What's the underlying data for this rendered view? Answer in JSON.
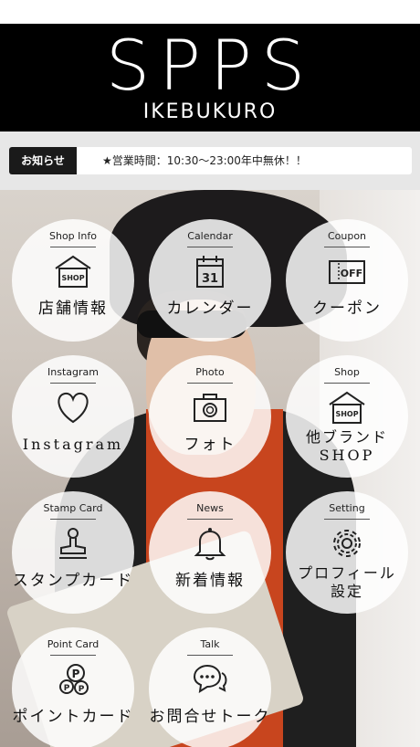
{
  "header": {
    "brand": "SPPS",
    "location": "IKEBUKURO"
  },
  "notice": {
    "label": "お知らせ",
    "text": "★営業時間：10:30〜23:00年中無休！！"
  },
  "menu": [
    {
      "en": "Shop Info",
      "jp": "店舗情報",
      "icon": "shop-icon"
    },
    {
      "en": "Calendar",
      "jp": "カレンダー",
      "icon": "calendar-icon",
      "day": "31"
    },
    {
      "en": "Coupon",
      "jp": "クーポン",
      "icon": "coupon-icon",
      "tag": "OFF"
    },
    {
      "en": "Instagram",
      "jp": "Instagram",
      "icon": "heart-icon"
    },
    {
      "en": "Photo",
      "jp": "フォト",
      "icon": "camera-icon"
    },
    {
      "en": "Shop",
      "jp": "他ブランドSHOP",
      "jp_line1": "他ブランド",
      "jp_line2": "SHOP",
      "icon": "shop-icon"
    },
    {
      "en": "Stamp Card",
      "jp": "スタンプカード",
      "icon": "stamp-icon"
    },
    {
      "en": "News",
      "jp": "新着情報",
      "icon": "bell-icon"
    },
    {
      "en": "Setting",
      "jp": "プロフィール設定",
      "jp_line1": "プロフィール",
      "jp_line2": "設定",
      "icon": "gear-icon"
    },
    {
      "en": "Point Card",
      "jp": "ポイントカード",
      "icon": "points-icon",
      "badge": "P"
    },
    {
      "en": "Talk",
      "jp": "お問合せトーク",
      "icon": "chat-icon"
    }
  ],
  "shop_tag": "SHOP"
}
